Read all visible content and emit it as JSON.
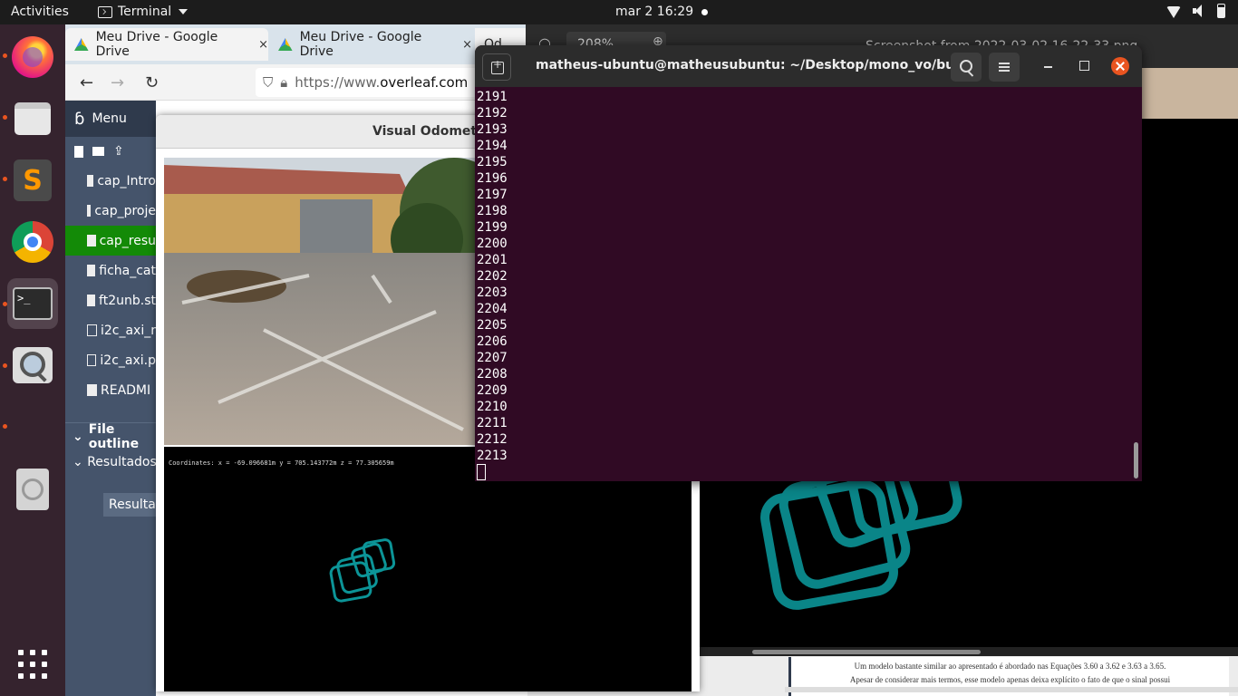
{
  "topbar": {
    "activities": "Activities",
    "app_name": "Terminal",
    "clock": "mar 2  16:29",
    "icons": [
      "wifi-icon",
      "volume-icon",
      "battery-icon"
    ]
  },
  "dock": {
    "items": [
      "firefox",
      "files",
      "sublime-text",
      "chrome",
      "terminal",
      "image-viewer",
      "disc"
    ],
    "terminal_prompt": ">_"
  },
  "browser": {
    "tabs": [
      {
        "title": "Meu Drive - Google Drive",
        "close": "×"
      },
      {
        "title": "Meu Drive - Google Drive",
        "close": "×"
      },
      {
        "title": "Od",
        "close": ""
      }
    ],
    "url_prefix": "https://www.",
    "url_domain": "overleaf.com"
  },
  "overleaf": {
    "menu_label": "Menu",
    "files": [
      "cap_Intro",
      "cap_proje",
      "cap_resu",
      "ficha_cat",
      "ft2unb.st",
      "i2c_axi_r",
      "i2c_axi.p",
      "READMI"
    ],
    "file_types": [
      "doc",
      "doc",
      "doc",
      "doc",
      "doc",
      "img",
      "img",
      "doc"
    ],
    "selected_file": "cap_resu",
    "outline_title": "File outline",
    "outline_item": "Resultados",
    "outline_sub": "Resultado"
  },
  "pdf": {
    "line1": "Um modelo bastante similar ao apresentado é abordado nas Equações 3.60 a 3.62 e 3.63 a 3.65.",
    "line2": "Apesar de considerar mais termos, esse modelo apenas deixa explícito o fato de que o sinal possui"
  },
  "viewer": {
    "title": "Screenshot from 2022-03-02 16-22-33.png",
    "zoom": "208%"
  },
  "vo": {
    "title": "Visual Odometry",
    "coordinates": "Coordinates: x = -69.096681m y = 705.143772m z = 77.305659m"
  },
  "terminal": {
    "title": "matheus-ubuntu@matheusubuntu: ~/Desktop/mono_vo/build",
    "lines": [
      "2191",
      "2192",
      "2193",
      "2194",
      "2195",
      "2196",
      "2197",
      "2198",
      "2199",
      "2200",
      "2201",
      "2202",
      "2203",
      "2204",
      "2205",
      "2206",
      "2207",
      "2208",
      "2209",
      "2210",
      "2211",
      "2212",
      "2213"
    ]
  },
  "colors": {
    "terminal_bg": "#300a24",
    "overleaf_green": "#138a07",
    "trajectory": "#0c9497",
    "ubuntu_orange": "#e95420"
  }
}
